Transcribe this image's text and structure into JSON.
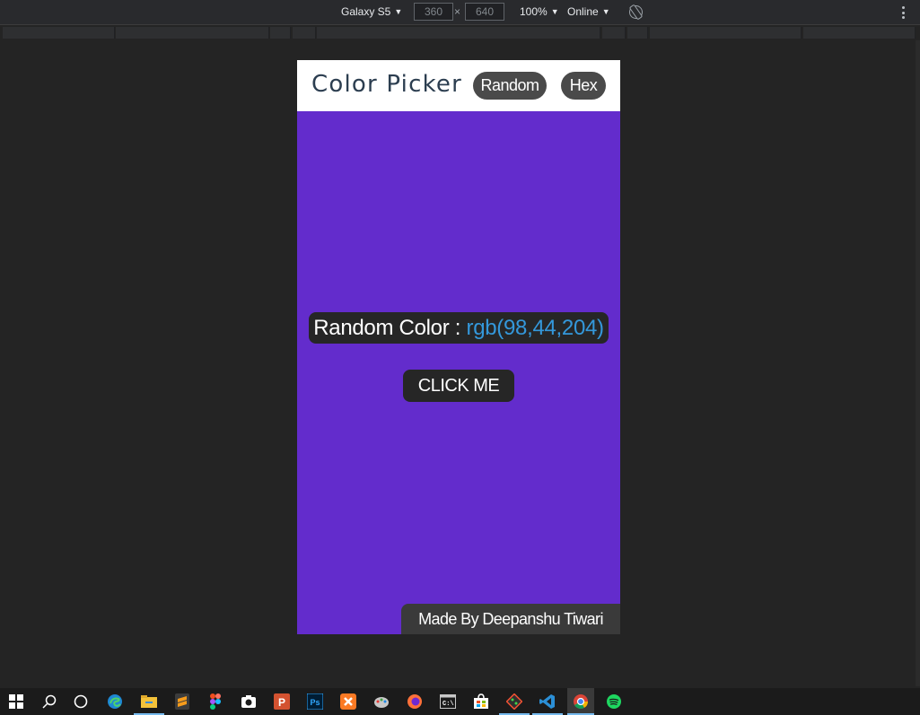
{
  "devtools": {
    "device": "Galaxy S5",
    "width": "360",
    "height": "640",
    "zoom": "100%",
    "network": "Online"
  },
  "app": {
    "title": "Color Picker",
    "nav": {
      "random_label": "Random",
      "hex_label": "Hex"
    },
    "color_display": {
      "prefix": "Random Color :",
      "value": "rgb(98,44,204)"
    },
    "button_label": "CLICK ME",
    "footer": "Made By Deepanshu Tiwari",
    "colors": {
      "background": "#632ccc",
      "header": "#ffffff",
      "title": "#2c3e50",
      "value": "#3498db",
      "pill": "#4a4a4a",
      "dark_box": "#262626"
    }
  },
  "taskbar": {
    "icons": [
      "windows-start-icon",
      "search-icon",
      "cortana-icon",
      "edge-icon",
      "file-explorer-icon",
      "sublime-icon",
      "figma-icon",
      "camera-icon",
      "powerpoint-icon",
      "photoshop-icon",
      "xampp-icon",
      "paint-icon",
      "firefox-icon",
      "terminal-icon",
      "store-icon",
      "git-icon",
      "vscode-icon",
      "chrome-icon",
      "spotify-icon"
    ]
  }
}
